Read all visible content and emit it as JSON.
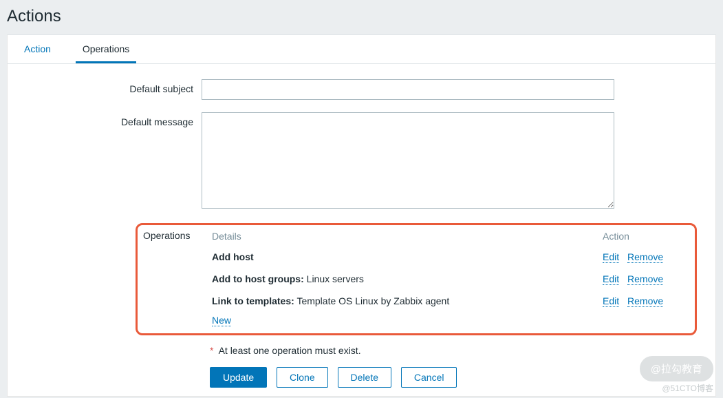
{
  "page_title": "Actions",
  "tabs": {
    "action": "Action",
    "operations": "Operations"
  },
  "form": {
    "default_subject_label": "Default subject",
    "default_subject_value": "",
    "default_message_label": "Default message",
    "default_message_value": "",
    "operations_label": "Operations"
  },
  "ops_table": {
    "head_details": "Details",
    "head_action": "Action",
    "rows": [
      {
        "label": "Add host",
        "value": ""
      },
      {
        "label": "Add to host groups:",
        "value": "Linux servers"
      },
      {
        "label": "Link to templates:",
        "value": "Template OS Linux by Zabbix agent"
      }
    ],
    "edit_label": "Edit",
    "remove_label": "Remove",
    "new_label": "New"
  },
  "required_note": "At least one operation must exist.",
  "buttons": {
    "update": "Update",
    "clone": "Clone",
    "delete": "Delete",
    "cancel": "Cancel"
  },
  "watermark1": "@拉勾教育",
  "watermark2": "@51CTO博客"
}
